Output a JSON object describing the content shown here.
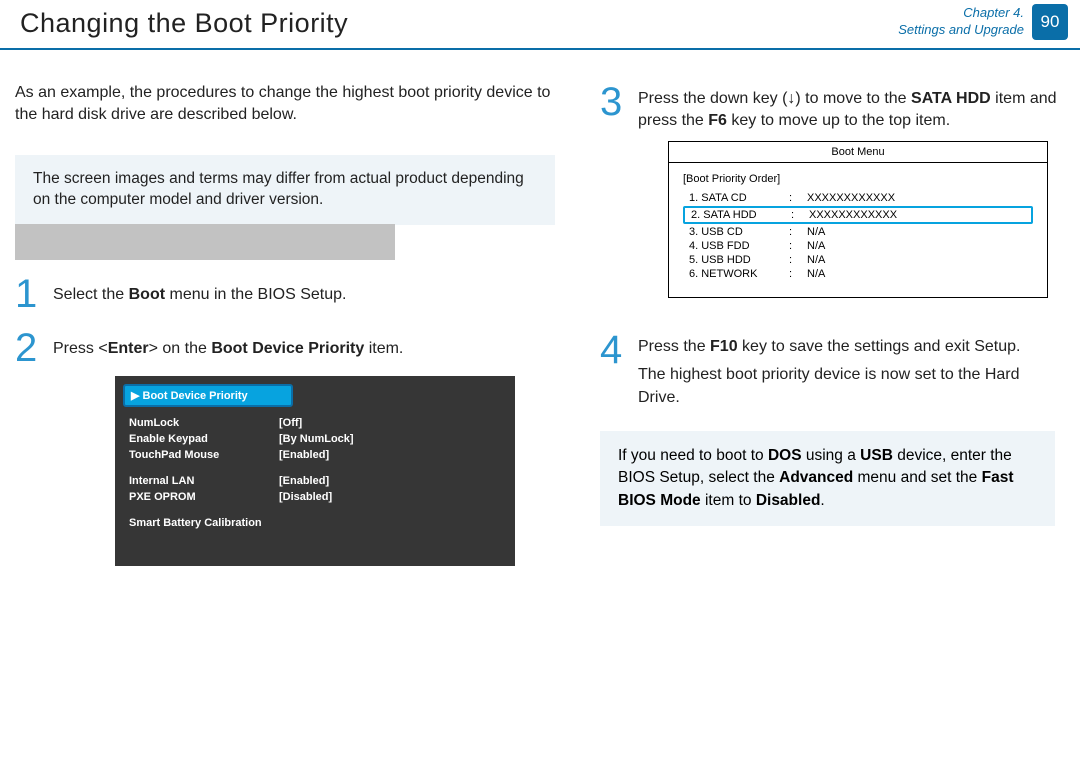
{
  "header": {
    "title": "Changing the Boot Priority",
    "chapter_line1": "Chapter 4.",
    "chapter_line2": "Settings and Upgrade",
    "page_number": "90"
  },
  "left": {
    "intro": "As an example, the procedures to change the highest boot priority device to the hard disk drive are described below.",
    "note": "The screen images and terms may differ from actual product depending on the computer model and driver version.",
    "step1_pre": "Select the ",
    "step1_bold": "Boot",
    "step1_post": " menu in the BIOS Setup.",
    "step2_pre": "Press <",
    "step2_bold": "Enter",
    "step2_mid": "> on the ",
    "step2_bold2": "Boot Device Priority",
    "step2_post": " item.",
    "bios": {
      "highlight": "▶ Boot Device Priority",
      "rows": [
        {
          "label": "NumLock",
          "val": "[Off]"
        },
        {
          "label": "Enable Keypad",
          "val": "[By NumLock]"
        },
        {
          "label": "TouchPad Mouse",
          "val": "[Enabled]"
        }
      ],
      "rows2": [
        {
          "label": "Internal LAN",
          "val": "[Enabled]"
        },
        {
          "label": "PXE OPROM",
          "val": "[Disabled]"
        }
      ],
      "footer": "Smart Battery Calibration"
    }
  },
  "right": {
    "step3_pre": "Press the down key (↓) to move to the ",
    "step3_b1": "SATA HDD",
    "step3_mid": " item and press the ",
    "step3_b2": "F6",
    "step3_post": " key to move up to the top item.",
    "boot_menu": {
      "title": "Boot Menu",
      "subtitle": "[Boot Priority Order]",
      "rows": [
        {
          "idx": "1. SATA CD",
          "val": "XXXXXXXXXXXX",
          "sel": false
        },
        {
          "idx": "2. SATA HDD",
          "val": "XXXXXXXXXXXX",
          "sel": true
        },
        {
          "idx": "3. USB CD",
          "val": "N/A",
          "sel": false
        },
        {
          "idx": "4. USB FDD",
          "val": "N/A",
          "sel": false
        },
        {
          "idx": "5. USB HDD",
          "val": "N/A",
          "sel": false
        },
        {
          "idx": "6. NETWORK",
          "val": "N/A",
          "sel": false
        }
      ]
    },
    "step4_pre": "Press the ",
    "step4_b1": "F10",
    "step4_mid": " key to save the settings and exit Setup.",
    "step4_line2": "The highest boot priority device is now set to the Hard Drive.",
    "tip_pre": "If you need to boot to ",
    "tip_b1": "DOS",
    "tip_m1": " using a ",
    "tip_b2": "USB",
    "tip_m2": " device, enter the BIOS Setup, select the ",
    "tip_b3": "Advanced",
    "tip_m3": " menu and set the ",
    "tip_b4": "Fast BIOS Mode",
    "tip_m4": " item to ",
    "tip_b5": "Disabled",
    "tip_post": "."
  },
  "step_numbers": {
    "n1": "1",
    "n2": "2",
    "n3": "3",
    "n4": "4"
  }
}
